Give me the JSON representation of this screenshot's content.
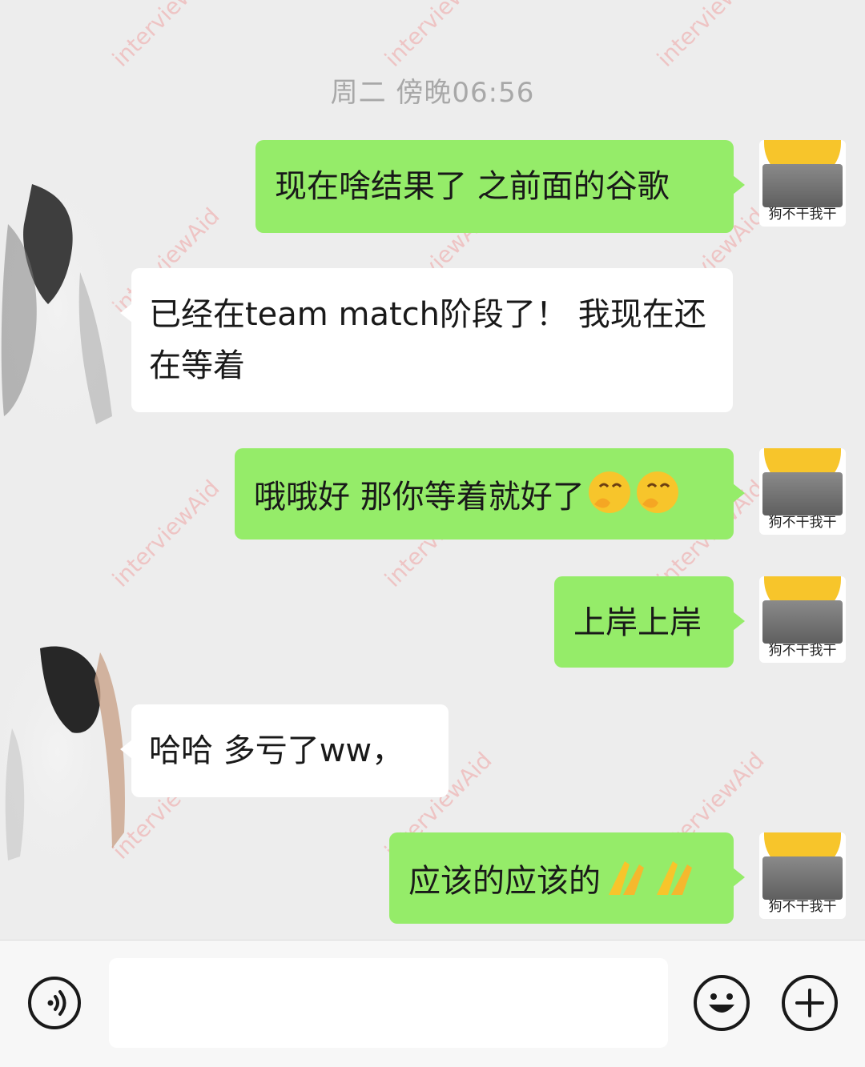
{
  "timestamp": "周二 傍晚06:56",
  "messages": [
    {
      "side": "out",
      "text": "现在啥结果了 之前面的谷歌"
    },
    {
      "side": "in",
      "text": "已经在team match阶段了！ 我现在还在等着"
    },
    {
      "side": "out",
      "text": "哦哦好 那你等着就好了",
      "emoji": "hand-over-mouth-emoji"
    },
    {
      "side": "out",
      "text": "上岸上岸"
    },
    {
      "side": "in",
      "text": "哈哈 多亏了ww，"
    },
    {
      "side": "out",
      "text": "应该的应该的",
      "emoji": "praying-hands-emoji"
    }
  ],
  "my_avatar_caption": "狗不干我干",
  "watermark_text": "interviewAid",
  "colors": {
    "outgoing_bubble": "#95ec69",
    "incoming_bubble": "#ffffff",
    "background": "#ededed"
  },
  "toolbar": {
    "voice_icon": "voice-icon",
    "emoji_icon": "emoji-smile-icon",
    "plus_icon": "plus-icon"
  }
}
